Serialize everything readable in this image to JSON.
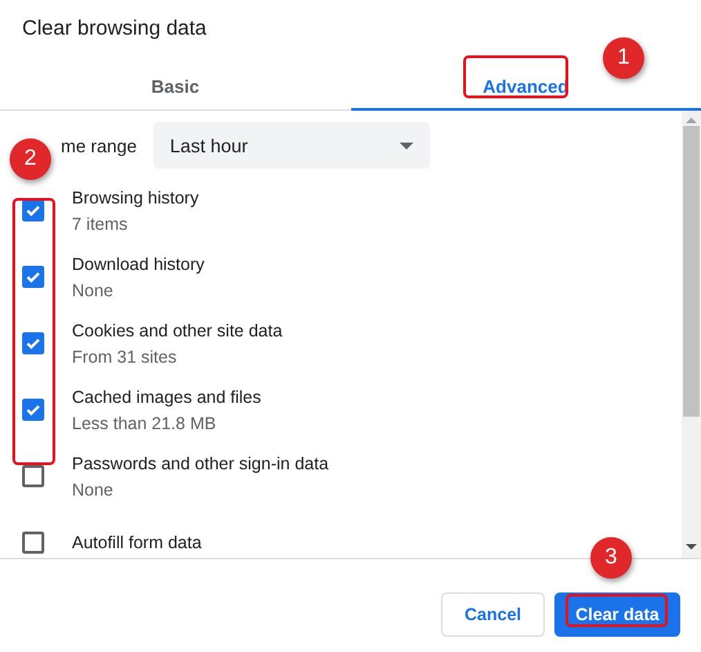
{
  "dialog": {
    "title": "Clear browsing data"
  },
  "tabs": [
    {
      "label": "Basic",
      "selected": false
    },
    {
      "label": "Advanced",
      "selected": true
    }
  ],
  "time_range": {
    "label": "me range",
    "value": "Last hour"
  },
  "items": [
    {
      "title": "Browsing history",
      "detail": "7 items",
      "checked": true
    },
    {
      "title": "Download history",
      "detail": "None",
      "checked": true
    },
    {
      "title": "Cookies and other site data",
      "detail": "From 31 sites",
      "checked": true
    },
    {
      "title": "Cached images and files",
      "detail": "Less than 21.8 MB",
      "checked": true
    },
    {
      "title": "Passwords and other sign-in data",
      "detail": "None",
      "checked": false
    },
    {
      "title": "Autofill form data",
      "checked": false
    }
  ],
  "buttons": [
    {
      "label": "Cancel",
      "kind": "secondary"
    },
    {
      "label": "Clear data",
      "kind": "primary"
    }
  ],
  "annotations": [
    {
      "label": "1"
    },
    {
      "label": "2"
    },
    {
      "label": "3"
    }
  ]
}
